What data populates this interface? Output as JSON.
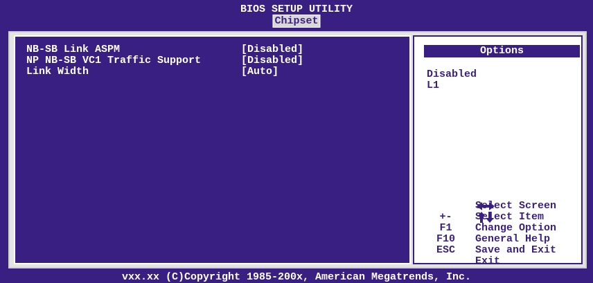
{
  "header": {
    "title": "BIOS SETUP UTILITY",
    "active_tab": "Chipset"
  },
  "settings": [
    {
      "label": "NB-SB Link ASPM",
      "value": "[Disabled]"
    },
    {
      "label": "NP NB-SB VC1 Traffic Support",
      "value": "[Disabled]"
    },
    {
      "label": "Link Width",
      "value": "[Auto]"
    }
  ],
  "options_panel": {
    "title": "Options",
    "items": [
      "Disabled",
      "L1"
    ]
  },
  "help": [
    {
      "key_icon": "left-right-arrows-icon",
      "key": "",
      "desc": "Select Screen"
    },
    {
      "key_icon": "up-down-arrows-icon",
      "key": "",
      "desc": "Select Item"
    },
    {
      "key_icon": "",
      "key": "+-",
      "desc": "Change Option"
    },
    {
      "key_icon": "",
      "key": "F1",
      "desc": "General Help"
    },
    {
      "key_icon": "",
      "key": "F10",
      "desc": "Save and Exit"
    },
    {
      "key_icon": "",
      "key": "ESC",
      "desc": "Exit"
    }
  ],
  "footer": {
    "copyright": "vxx.xx (C)Copyright 1985-200x, American Megatrends, Inc."
  },
  "colors": {
    "bios_blue": "#3a1f82",
    "panel_grey": "#e4e4e4",
    "text_white": "#ffffff"
  }
}
